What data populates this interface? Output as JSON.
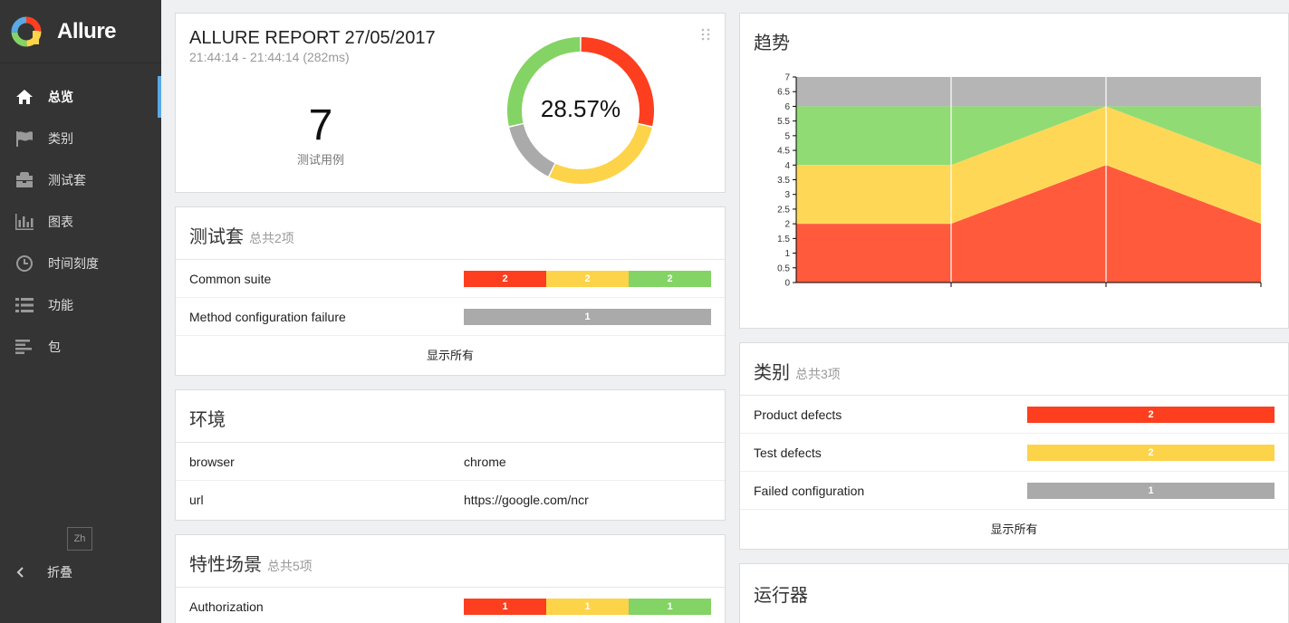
{
  "app": {
    "name": "Allure"
  },
  "sidebar": {
    "items": [
      {
        "label": "总览",
        "icon": "home-icon",
        "active": true
      },
      {
        "label": "类别",
        "icon": "flag-icon",
        "active": false
      },
      {
        "label": "测试套",
        "icon": "briefcase-icon",
        "active": false
      },
      {
        "label": "图表",
        "icon": "bar-chart-icon",
        "active": false
      },
      {
        "label": "时间刻度",
        "icon": "clock-icon",
        "active": false
      },
      {
        "label": "功能",
        "icon": "list-icon",
        "active": false
      },
      {
        "label": "包",
        "icon": "align-left-icon",
        "active": false
      }
    ],
    "language": "Zh",
    "collapse_label": "折叠"
  },
  "summary": {
    "title": "ALLURE REPORT 27/05/2017",
    "time_range": "21:44:14 - 21:44:14 (282ms)",
    "total": "7",
    "total_label": "测试用例",
    "percent": "28.57%",
    "donut": {
      "failed": 2,
      "broken": 2,
      "passed": 2,
      "unknown": 1
    }
  },
  "suites": {
    "title": "测试套",
    "count_label": "总共2项",
    "rows": [
      {
        "name": "Common suite",
        "segments": [
          {
            "color": "red",
            "value": "2"
          },
          {
            "color": "yellow",
            "value": "2"
          },
          {
            "color": "green",
            "value": "2"
          }
        ]
      },
      {
        "name": "Method configuration failure",
        "segments": [
          {
            "color": "gray",
            "value": "1"
          }
        ]
      }
    ],
    "show_all": "显示所有"
  },
  "environment": {
    "title": "环境",
    "rows": [
      {
        "key": "browser",
        "value": "chrome"
      },
      {
        "key": "url",
        "value": "https://google.com/ncr"
      }
    ]
  },
  "features": {
    "title": "特性场景",
    "count_label": "总共5项",
    "rows": [
      {
        "name": "Authorization",
        "segments": [
          {
            "color": "red",
            "value": "1"
          },
          {
            "color": "yellow",
            "value": "1"
          },
          {
            "color": "green",
            "value": "1"
          }
        ]
      }
    ]
  },
  "trend": {
    "title": "趋势"
  },
  "categories": {
    "title": "类别",
    "count_label": "总共3项",
    "rows": [
      {
        "name": "Product defects",
        "color": "red",
        "value": "2"
      },
      {
        "name": "Test defects",
        "color": "yellow",
        "value": "2"
      },
      {
        "name": "Failed configuration",
        "color": "gray",
        "value": "1"
      }
    ],
    "show_all": "显示所有"
  },
  "executors": {
    "title": "运行器"
  },
  "colors": {
    "failed": "#fd3f1f",
    "broken": "#fdd34a",
    "passed": "#84d365",
    "unknown": "#aaaaaa",
    "accent": "#5aa9e6"
  },
  "chart_data": {
    "type": "area",
    "x": [
      "",
      "",
      "",
      ""
    ],
    "ylim": [
      0,
      7
    ],
    "yticks": [
      "0",
      "0.5",
      "1",
      "1.5",
      "2",
      "2.5",
      "3",
      "3.5",
      "4",
      "4.5",
      "5",
      "5.5",
      "6",
      "6.5",
      "7"
    ],
    "series": [
      {
        "color": "#ff5a3c",
        "values": [
          2,
          2,
          4,
          2
        ]
      },
      {
        "color": "#ffd757",
        "values": [
          2,
          2,
          2,
          2
        ]
      },
      {
        "color": "#91db74",
        "values": [
          2,
          2,
          0,
          2
        ]
      },
      {
        "color": "#b5b5b5",
        "values": [
          1,
          1,
          1,
          1
        ]
      }
    ]
  }
}
